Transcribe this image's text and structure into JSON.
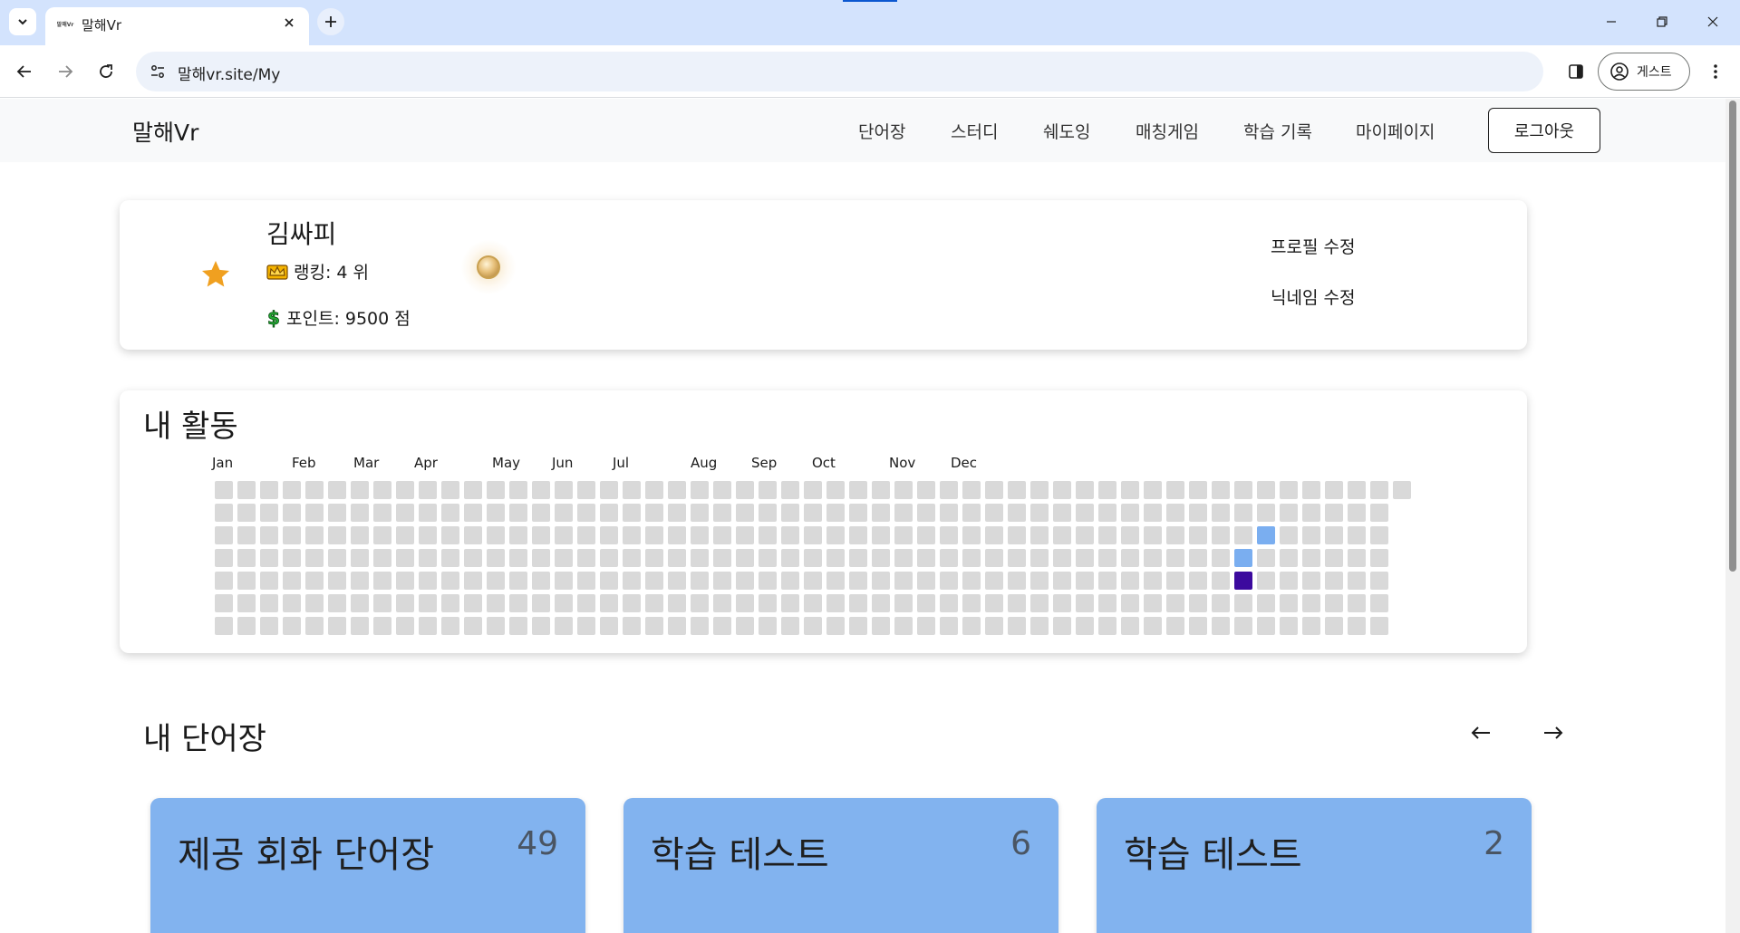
{
  "browser": {
    "tab_title": "말해Vr",
    "tab_favicon_text": "말해Vr",
    "url": "말해vr.site/My",
    "profile_label": "게스트"
  },
  "nav": {
    "brand": "말해Vr",
    "items": [
      "단어장",
      "스터디",
      "쉐도잉",
      "매칭게임",
      "학습 기록",
      "마이페이지"
    ],
    "logout": "로그아웃"
  },
  "profile": {
    "name": "김싸피",
    "rank_label": "랭킹: 4 위",
    "points_label": "포인트: 9500 점",
    "edit_profile": "프로필 수정",
    "edit_nickname": "닉네임 수정"
  },
  "activity": {
    "title": "내 활동",
    "months": [
      "Jan",
      "Feb",
      "Mar",
      "Apr",
      "May",
      "Jun",
      "Jul",
      "Aug",
      "Sep",
      "Oct",
      "Nov",
      "Dec"
    ],
    "weeks": 53,
    "days_per_week": 7,
    "first_week_offset": 0,
    "last_week_days": 1,
    "empty_color": "#d9d9d9",
    "active_cells": [
      {
        "week": 46,
        "day": 2,
        "color": "#7aaef0"
      },
      {
        "week": 45,
        "day": 3,
        "color": "#7aaef0"
      },
      {
        "week": 45,
        "day": 4,
        "color": "#3c0a9e"
      }
    ]
  },
  "vocab": {
    "title": "내 단어장",
    "cards": [
      {
        "title": "제공 회화 단어장",
        "count": "49"
      },
      {
        "title": "학습 테스트",
        "count": "6"
      },
      {
        "title": "학습 테스트",
        "count": "2"
      }
    ],
    "card_color": "#82b3ef"
  }
}
